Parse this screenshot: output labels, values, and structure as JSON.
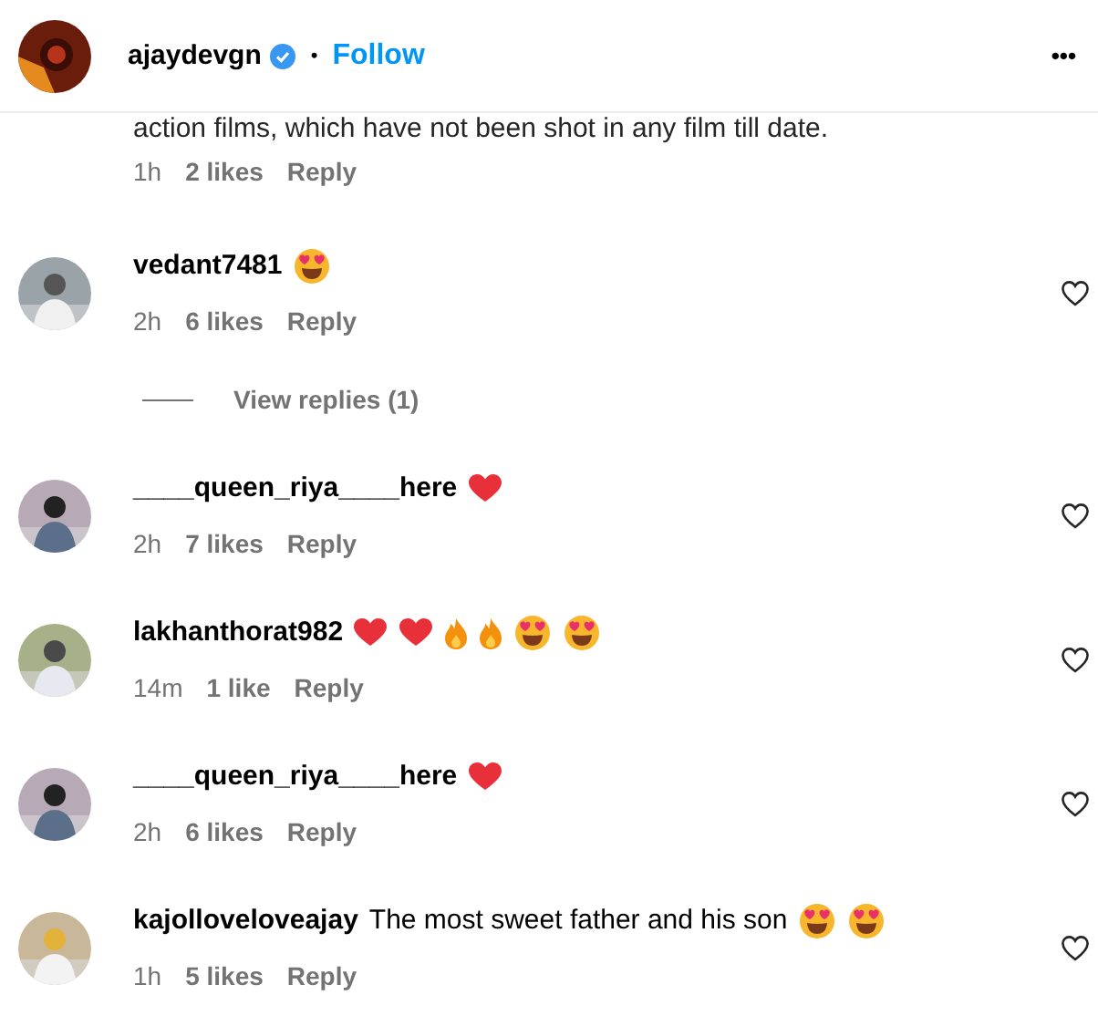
{
  "header": {
    "username": "ajaydevgn",
    "verified": true,
    "separator": "•",
    "follow": "Follow",
    "more": "•••"
  },
  "partial_comment": {
    "text": "action films, which have not been shot in any film till date.",
    "time": "1h",
    "likes": "2 likes",
    "reply": "Reply"
  },
  "comments": [
    {
      "username": "vedant7481",
      "emojis": [
        {
          "kind": "heart_eyes"
        }
      ],
      "time": "2h",
      "likes": "6 likes",
      "reply": "Reply",
      "liked": false,
      "view_replies": "View replies (1)"
    },
    {
      "username": "____queen_riya____here",
      "emojis": [
        {
          "kind": "heart"
        }
      ],
      "time": "2h",
      "likes": "7 likes",
      "reply": "Reply",
      "liked": false
    },
    {
      "username": "lakhanthorat982",
      "emojis": [
        {
          "kind": "heart"
        },
        {
          "kind": "heart"
        },
        {
          "kind": "fire"
        },
        {
          "kind": "fire"
        },
        {
          "kind": "heart_eyes"
        },
        {
          "kind": "heart_eyes"
        }
      ],
      "time": "14m",
      "likes": "1 like",
      "reply": "Reply",
      "liked": false
    },
    {
      "username": "____queen_riya____here",
      "emojis": [
        {
          "kind": "heart"
        }
      ],
      "time": "2h",
      "likes": "6 likes",
      "reply": "Reply",
      "liked": false
    },
    {
      "username": "kajolloveloveajay",
      "text": "The most sweet father and his son",
      "emojis": [
        {
          "kind": "heart_eyes"
        },
        {
          "kind": "heart_eyes"
        }
      ],
      "time": "1h",
      "likes": "5 likes",
      "reply": "Reply",
      "liked": false
    }
  ]
}
